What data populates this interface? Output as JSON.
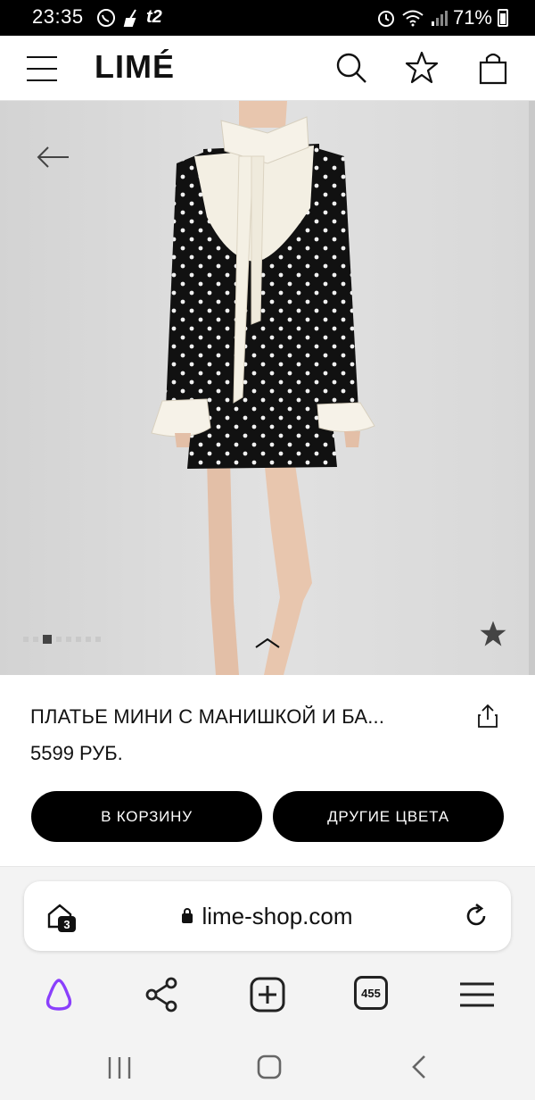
{
  "status_bar": {
    "time": "23:35",
    "carrier": "t2",
    "battery": "71%"
  },
  "header": {
    "logo": "LIMÉ",
    "icons": [
      "menu-icon",
      "search-icon",
      "star-icon",
      "bag-icon"
    ]
  },
  "gallery": {
    "image": "product-photo-polka-dot-dress",
    "dots_total": 8,
    "active_dot": 3
  },
  "product": {
    "title": "ПЛАТЬЕ МИНИ С МАНИШКОЙ И БА...",
    "price": "5599 РУБ.",
    "add_to_cart": "В КОРЗИНУ",
    "other_colors": "ДРУГИЕ ЦВЕТА"
  },
  "browser": {
    "url": "lime-shop.com",
    "tabs_badge": "3",
    "tab_count": "455"
  },
  "colors": {
    "accent_alice": "#8a3ffc",
    "button_bg": "#000000"
  }
}
